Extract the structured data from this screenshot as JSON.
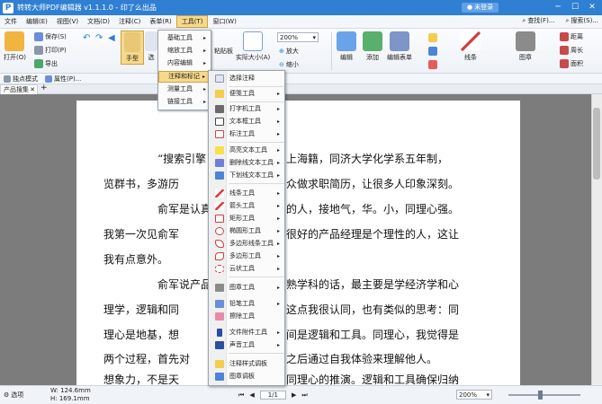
{
  "window": {
    "title": "转转大师PDF编辑器 v1.1.1.0 - 印了么出品",
    "logo": "P",
    "login_label": "未登录",
    "minimize": "─",
    "maximize": "☐",
    "close": "✕"
  },
  "menubar": {
    "items": [
      "文件",
      "编辑(E)",
      "视图(V)",
      "文档(D)",
      "注释(C)",
      "表单(R)",
      "工具(T)",
      "窗口(W)"
    ],
    "find_label": "查找(F)...",
    "search_label": "搜索(S)..."
  },
  "toolbar": {
    "open_label": "打开(O)",
    "save_label": "保存(S)",
    "print_label": "打印(P)",
    "export_label": "导出",
    "hand_label": "手型",
    "select_label": "选",
    "zoom_value": "200%",
    "zoom_in": "放大",
    "zoom_out": "缩小",
    "actual_size": "实际大小(A)",
    "paste_label": "粘贴板",
    "edit_label": "编辑",
    "add_label": "添加",
    "edit_form_label": "编辑表单",
    "line_label": "线条",
    "stamp_label": "图章",
    "distance_label": "距离",
    "perimeter_label": "周长",
    "area_label": "面积"
  },
  "modebar": {
    "exclusive_mode": "独点模式",
    "properties": "属性(P)..."
  },
  "tabs": {
    "items": [
      "产品搜集"
    ]
  },
  "tools_menu": {
    "items": [
      "基础工具",
      "缩放工具",
      "内容编辑",
      "注释和标记",
      "测量工具",
      "链接工具"
    ]
  },
  "annot_menu": {
    "items": [
      "选择注释",
      "便笺工具",
      "打字机工具",
      "文本框工具",
      "标注工具",
      "高亮文本工具",
      "删除线文本工具",
      "下划线文本工具",
      "线条工具",
      "箭头工具",
      "矩形工具",
      "椭圆形工具",
      "多边形线条工具",
      "多边形工具",
      "云状工具",
      "图章工具",
      "铅笔工具",
      "擦除工具",
      "文件附件工具",
      "声音工具",
      "注释样式调板",
      "图章调板"
    ]
  },
  "document": {
    "lines": [
      "“搜索引擎",
      "上海籍，同济大学化学系五年制，",
      "览群书，多游历",
      "众做求职简历，让很多人印象深刻。",
      "俞军是认真",
      "的人，接地气，华。小，同理心强。",
      "我第一次见俞军",
      "很好的产品经理是个理性的人，这让",
      "我有点意外。",
      "俞军说产品",
      "熟学科的话，最主要是学经济学和心",
      "理学，逻辑和同",
      "这点我很认同，也有类似的思考：同",
      "理心是地基，想",
      "间是逻辑和工具。同理心，我觉得是",
      "两个过程，首先对",
      "之后通过自我体验来理解他人。",
      "想象力，不是天",
      "同理心的推演。逻辑和工具确保归纳"
    ]
  },
  "statusbar": {
    "select_label": "选项",
    "width": "W: 124.6mm",
    "height": "H: 169.1mm",
    "page": "1/1",
    "zoom": "200%"
  },
  "colors": {
    "titlebar": "#2f7fd3",
    "highlight": "#f7d98a",
    "doc_bg": "#7c7c7c"
  }
}
